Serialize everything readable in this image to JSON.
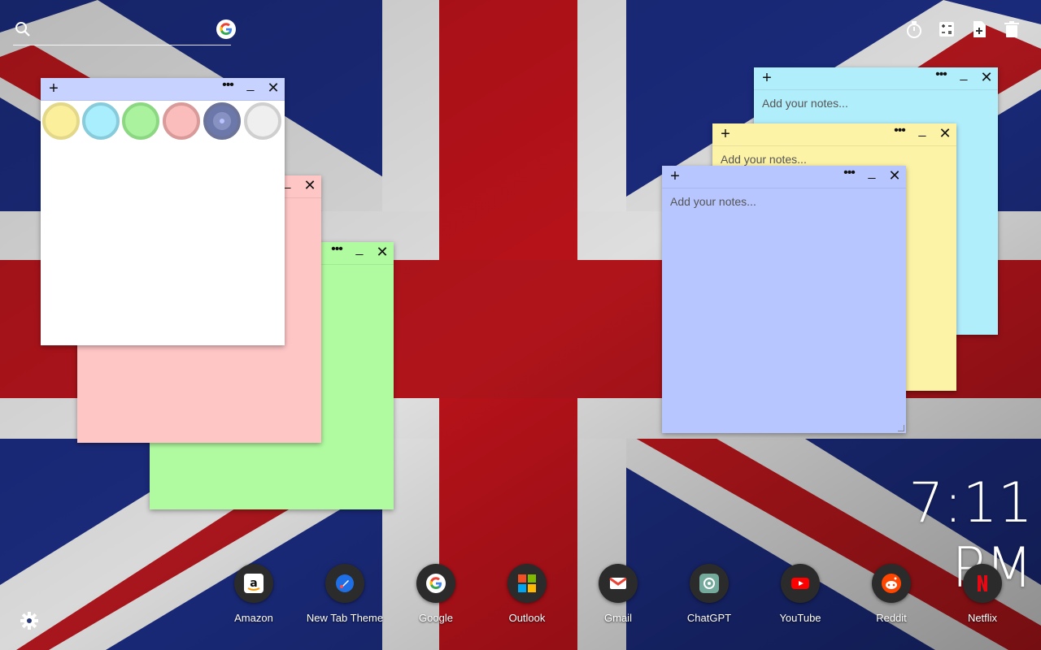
{
  "search": {
    "placeholder": ""
  },
  "toolbar": {
    "items": [
      {
        "icon": "timer-icon"
      },
      {
        "icon": "calculator-icon"
      },
      {
        "icon": "new-note-icon"
      },
      {
        "icon": "trash-icon"
      }
    ]
  },
  "notes": {
    "placeholder": "Add your notes...",
    "add_glyph": "+",
    "more_glyph": "•••",
    "min_glyph": "_",
    "close_glyph": "✕",
    "colors": {
      "cyan": "#b1eefc",
      "yellow": "#fdf3a7",
      "blue": "#b8c6ff",
      "green": "#b0fba0",
      "pink": "#ffc6c6",
      "white": "#ffffff"
    },
    "swatches": [
      "#fbef9c",
      "#a9eefc",
      "#aaf29e",
      "#fbbcbc",
      "#8892c2",
      "#efefef"
    ]
  },
  "clock": {
    "time": "7:11 PM"
  },
  "shortcuts": [
    {
      "label": "Amazon",
      "icon": "amazon-icon"
    },
    {
      "label": "New Tab Theme",
      "icon": "new-tab-theme-icon"
    },
    {
      "label": "Google",
      "icon": "google-icon"
    },
    {
      "label": "Outlook",
      "icon": "outlook-icon"
    },
    {
      "label": "Gmail",
      "icon": "gmail-icon"
    },
    {
      "label": "ChatGPT",
      "icon": "chatgpt-icon"
    },
    {
      "label": "YouTube",
      "icon": "youtube-icon"
    },
    {
      "label": "Reddit",
      "icon": "reddit-icon"
    },
    {
      "label": "Netflix",
      "icon": "netflix-icon"
    }
  ],
  "settings": {
    "icon": "gear-icon"
  }
}
